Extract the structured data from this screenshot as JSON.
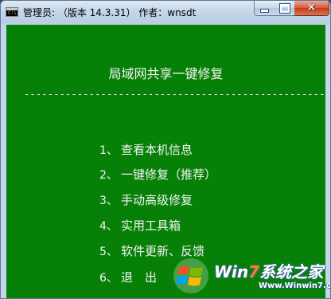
{
  "window": {
    "title": "管理员: （版本 14.3.31） 作者：wnsdt",
    "icon": "console-app-icon",
    "icon_text": "C:\\."
  },
  "controls": {
    "minimize_icon": "minimize-icon",
    "maximize_icon": "maximize-icon",
    "close_icon": "close-icon",
    "close_glyph": "✕"
  },
  "console": {
    "background_color": "#078007",
    "text_color": "#f4f4f4",
    "heading": "局域网共享一键修复",
    "separator": "------------------------------------------------------------",
    "menu": [
      {
        "number": "1、",
        "label": "查看本机信息"
      },
      {
        "number": "2、",
        "label": "一键修复（推荐）"
      },
      {
        "number": "3、",
        "label": "手动高级修复"
      },
      {
        "number": "4、",
        "label": "实用工具箱"
      },
      {
        "number": "5、",
        "label": "软件更新、反馈"
      },
      {
        "number": "6、",
        "label": "退　出"
      }
    ]
  },
  "watermark": {
    "brand_prefix": "Win",
    "brand_seven": "7",
    "brand_suffix": "系统之家",
    "url": "Www.Winwin7.com"
  }
}
